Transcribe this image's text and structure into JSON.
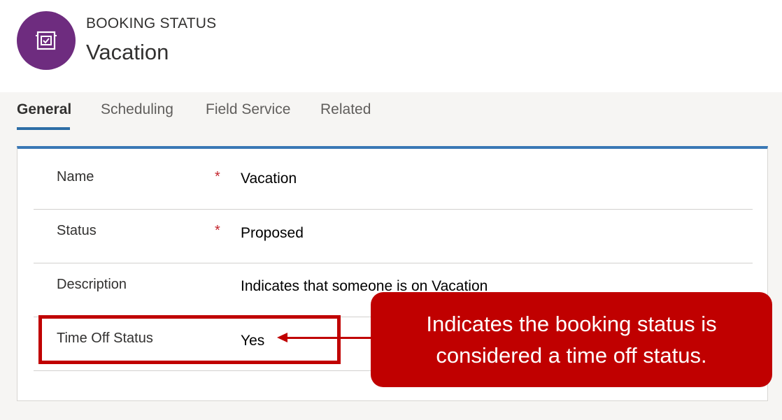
{
  "header": {
    "entity_label": "BOOKING STATUS",
    "record_title": "Vacation",
    "avatar_icon": "booking-status-icon",
    "avatar_color": "#6e2c7f"
  },
  "tabs": [
    {
      "label": "General",
      "active": true
    },
    {
      "label": "Scheduling",
      "active": false
    },
    {
      "label": "Field Service",
      "active": false
    },
    {
      "label": "Related",
      "active": false
    }
  ],
  "form": {
    "fields": [
      {
        "label": "Name",
        "required": true,
        "required_marker": "*",
        "value": "Vacation"
      },
      {
        "label": "Status",
        "required": true,
        "required_marker": "*",
        "value": "Proposed"
      },
      {
        "label": "Description",
        "required": false,
        "value": "Indicates that someone is on Vacation"
      },
      {
        "label": "Time Off Status",
        "required": false,
        "value": "Yes"
      }
    ]
  },
  "annotation": {
    "callout_text": "Indicates the booking status is considered a time off status.",
    "color": "#c00000"
  },
  "colors": {
    "accent": "#2e6ea6",
    "card_top_border": "#3a78b5",
    "required": "#c4262e",
    "background": "#f6f5f3"
  }
}
